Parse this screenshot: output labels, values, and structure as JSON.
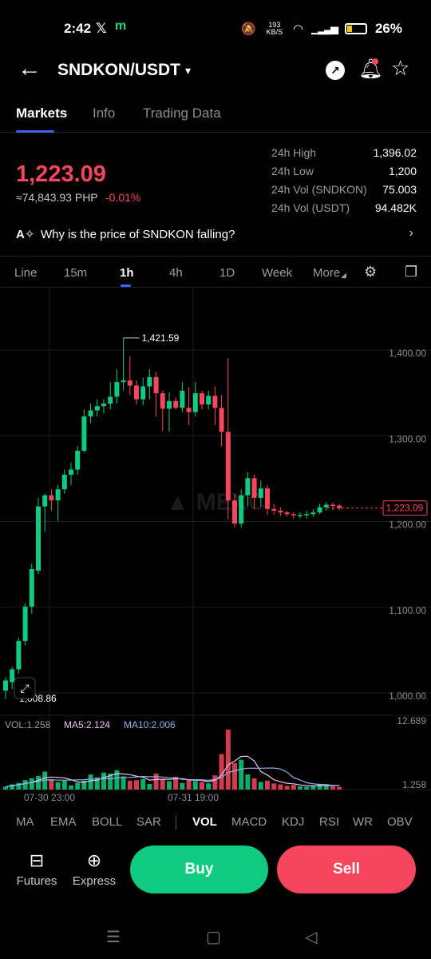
{
  "status_bar": {
    "time": "2:42",
    "x_glyph": "𝕏",
    "m_glyph": "m",
    "net_speed": "193 KB/S",
    "battery": "26%"
  },
  "header": {
    "pair": "SNDKON/USDT",
    "caret": "▾",
    "back_glyph": "←"
  },
  "tabs": [
    "Markets",
    "Info",
    "Trading Data"
  ],
  "price": {
    "last": "1,223.09",
    "php": "≈74,843.93 PHP",
    "change": "-0.01%"
  },
  "stats": [
    {
      "k": "24h High",
      "v": "1,396.02"
    },
    {
      "k": "24h Low",
      "v": "1,200"
    },
    {
      "k": "24h Vol (SNDKON)",
      "v": "75.003"
    },
    {
      "k": "24h Vol (USDT)",
      "v": "94.482K"
    }
  ],
  "why": {
    "text": "Why is the price of SNDKON falling?",
    "chevron": "›"
  },
  "intervals": [
    "Line",
    "15m",
    "1h",
    "4h",
    "1D",
    "Week",
    "More"
  ],
  "chart_data": {
    "type": "candlestick",
    "y_ticks": [
      "1,400.00",
      "1,300.00",
      "1,200.00",
      "1,100.00",
      "1,000.00"
    ],
    "last_price_label": "1,223.09",
    "high_marker": "1,421.59",
    "low_marker": "1,008.86",
    "vol_label": "VOL:1.258",
    "ma5_label": "MA5:2.124",
    "ma10_label": "MA10:2.006",
    "vol_max": "12.689",
    "vol_min": "1.258",
    "x_labels": [
      "07-30 23:00",
      "07-31 19:00"
    ],
    "colors": {
      "up": "#0ecb81",
      "down": "#f6465d",
      "ma5": "#e8c3f2",
      "ma10": "#8fb2e8"
    },
    "candles": [
      [
        1010,
        1022,
        1000,
        1026
      ],
      [
        1020,
        1035,
        1012,
        1038
      ],
      [
        1035,
        1068,
        1030,
        1072
      ],
      [
        1068,
        1108,
        1063,
        1112
      ],
      [
        1108,
        1152,
        1100,
        1158
      ],
      [
        1150,
        1225,
        1146,
        1235
      ],
      [
        1225,
        1238,
        1195,
        1240
      ],
      [
        1238,
        1232,
        1220,
        1245
      ],
      [
        1232,
        1245,
        1208,
        1250
      ],
      [
        1245,
        1262,
        1240,
        1268
      ],
      [
        1262,
        1268,
        1250,
        1276
      ],
      [
        1268,
        1290,
        1262,
        1295
      ],
      [
        1290,
        1330,
        1288,
        1338
      ],
      [
        1330,
        1337,
        1322,
        1345
      ],
      [
        1337,
        1342,
        1330,
        1350
      ],
      [
        1342,
        1345,
        1333,
        1350
      ],
      [
        1345,
        1353,
        1338,
        1370
      ],
      [
        1353,
        1370,
        1345,
        1385
      ],
      [
        1370,
        1372,
        1360,
        1421.59
      ],
      [
        1372,
        1366,
        1355,
        1400
      ],
      [
        1366,
        1350,
        1344,
        1372
      ],
      [
        1350,
        1365,
        1343,
        1375
      ],
      [
        1365,
        1376,
        1350,
        1385
      ],
      [
        1376,
        1357,
        1330,
        1382
      ],
      [
        1357,
        1339,
        1313,
        1360
      ],
      [
        1339,
        1348,
        1312,
        1358
      ],
      [
        1348,
        1340,
        1338,
        1352
      ],
      [
        1340,
        1360,
        1335,
        1370
      ],
      [
        1340,
        1335,
        1320,
        1364
      ],
      [
        1335,
        1357,
        1330,
        1370
      ],
      [
        1357,
        1344,
        1338,
        1360
      ],
      [
        1344,
        1354,
        1338,
        1360
      ],
      [
        1354,
        1340,
        1320,
        1365
      ],
      [
        1340,
        1312,
        1295,
        1355
      ],
      [
        1312,
        1232,
        1210,
        1398
      ],
      [
        1232,
        1205,
        1200,
        1240
      ],
      [
        1205,
        1238,
        1200,
        1245
      ],
      [
        1238,
        1258,
        1225,
        1265
      ],
      [
        1258,
        1235,
        1222,
        1262
      ],
      [
        1235,
        1246,
        1225,
        1255
      ],
      [
        1246,
        1222,
        1215,
        1250
      ],
      [
        1222,
        1220,
        1215,
        1228
      ],
      [
        1220,
        1218,
        1214,
        1224
      ],
      [
        1218,
        1216,
        1213,
        1220
      ],
      [
        1216,
        1215,
        1211,
        1218
      ],
      [
        1215,
        1215,
        1211,
        1218
      ],
      [
        1215,
        1216,
        1211,
        1220
      ],
      [
        1216,
        1218,
        1213,
        1222
      ],
      [
        1218,
        1224,
        1216,
        1228
      ],
      [
        1224,
        1227,
        1220,
        1230
      ],
      [
        1227,
        1226,
        1221,
        1230
      ],
      [
        1226,
        1223.09,
        1221,
        1228
      ]
    ],
    "volumes": [
      0.6,
      1.1,
      1.4,
      2.0,
      2.4,
      2.9,
      3.8,
      2.2,
      1.6,
      1.9,
      0.9,
      1.4,
      1.9,
      3.2,
      2.6,
      3.6,
      3.4,
      4.1,
      2.8,
      1.9,
      2.0,
      2.2,
      1.2,
      3.4,
      2.2,
      1.8,
      2.7,
      1.4,
      2.2,
      1.8,
      1.6,
      1.3,
      3.0,
      7.5,
      12.689,
      5.6,
      6.3,
      3.2,
      2.4,
      1.6,
      1.9,
      1.3,
      1.1,
      0.8,
      1.0,
      0.7,
      0.6,
      0.8,
      1.2,
      1.0,
      0.7,
      0.6
    ]
  },
  "indicators": [
    "MA",
    "EMA",
    "BOLL",
    "SAR",
    "VOL",
    "MACD",
    "KDJ",
    "RSI",
    "WR",
    "OBV"
  ],
  "bottom": {
    "futures": "Futures",
    "express": "Express",
    "buy": "Buy",
    "sell": "Sell"
  },
  "nav": {
    "menu": "☰",
    "home": "▢",
    "back": "◁"
  }
}
